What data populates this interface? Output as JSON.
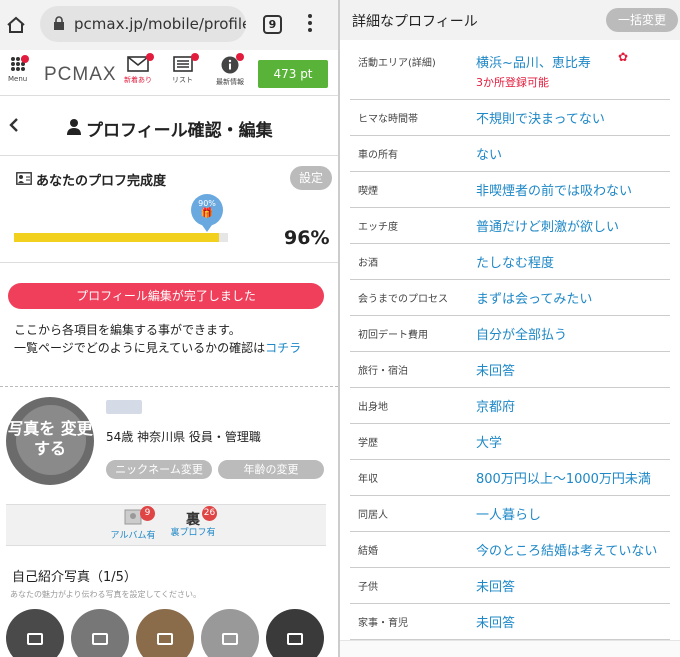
{
  "browser": {
    "url": "pcmax.jp/mobile/profile",
    "tab_count": "9"
  },
  "nav": {
    "logo": "PCMAX",
    "menu_label": "Menu",
    "mail_label": "新着あり",
    "list_label": "リスト",
    "info_label": "最新情報",
    "points": "473 pt"
  },
  "page": {
    "title": "プロフィール確認・編集"
  },
  "completion": {
    "title": "あなたのプロフ完成度",
    "settings_label": "設定",
    "balloon": "90%",
    "level": 0.96,
    "percent": "96%"
  },
  "notice": {
    "done": "プロフィール編集が完了しました",
    "line1": "ここから各項目を編集する事ができます。",
    "line2_prefix": "一覧ページでどのように見えているかの確認は",
    "line2_link": "コチラ"
  },
  "profile": {
    "photo_text": "写真を 変更する",
    "details": "54歳 神奈川県 役員・管理職",
    "nickname_button": "ニックネーム変更",
    "age_button": "年齢の変更"
  },
  "tabs": [
    {
      "label": "アルバム有",
      "badge": "9"
    },
    {
      "glyph": "裏",
      "label": "裏プロフ有",
      "badge": "26"
    }
  ],
  "photos": {
    "title": "自己紹介写真（1/5）",
    "subtitle": "あなたの魅力がより伝わる写真を設定してください。"
  },
  "detail": {
    "title": "詳細なプロフィール",
    "bulk_button": "一括変更",
    "rows": [
      {
        "label": "活動エリア(詳細)",
        "value": "横浜~品川、恵比寿",
        "note": "3か所登録可能"
      },
      {
        "label": "ヒマな時間帯",
        "value": "不規則で決まってない"
      },
      {
        "label": "車の所有",
        "value": "ない"
      },
      {
        "label": "喫煙",
        "value": "非喫煙者の前では吸わない"
      },
      {
        "label": "エッチ度",
        "value": "普通だけど刺激が欲しい"
      },
      {
        "label": "お酒",
        "value": "たしなむ程度"
      },
      {
        "label": "会うまでのプロセス",
        "value": "まずは会ってみたい"
      },
      {
        "label": "初回デート費用",
        "value": "自分が全部払う"
      },
      {
        "label": "旅行・宿泊",
        "value": "未回答"
      },
      {
        "label": "出身地",
        "value": "京都府"
      },
      {
        "label": "学歴",
        "value": "大学"
      },
      {
        "label": "年収",
        "value": "800万円以上～1000万円未満"
      },
      {
        "label": "同居人",
        "value": "一人暮らし"
      },
      {
        "label": "結婚",
        "value": "今のところ結婚は考えていない"
      },
      {
        "label": "子供",
        "value": "未回答"
      },
      {
        "label": "家事・育児",
        "value": "未回答"
      }
    ]
  },
  "colors": {
    "accent_blue": "#1f88c7",
    "done_red": "#ef3f5a",
    "points_green": "#59b338",
    "bar_yellow": "#f2d01e"
  }
}
